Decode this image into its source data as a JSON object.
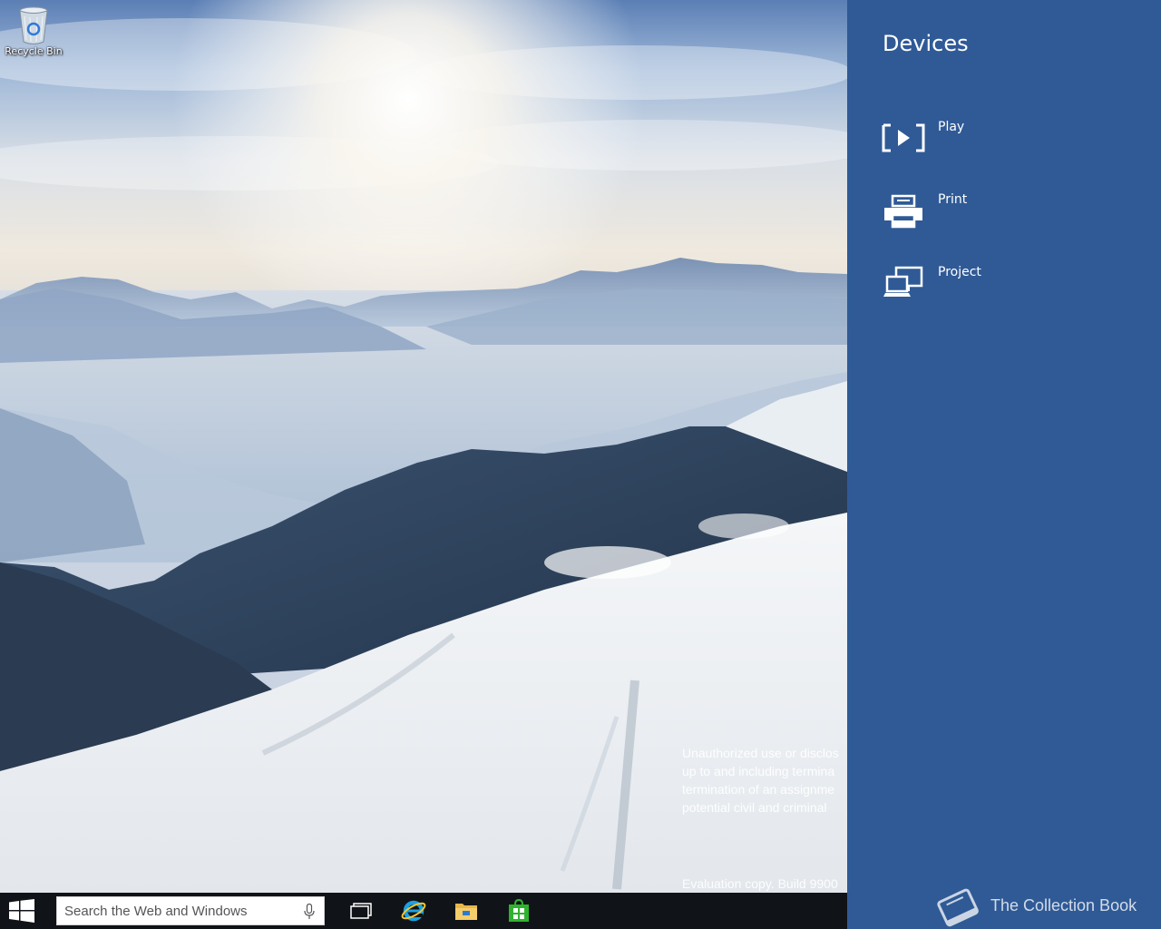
{
  "desktop": {
    "recycle_bin_label": "Recycle Bin",
    "watermark_lines": [
      "Unauthorized use or disclos",
      "up to and including termina",
      "termination of an assignme",
      "potential civil and criminal"
    ],
    "build_text": "Evaluation copy. Build 9900"
  },
  "taskbar": {
    "search_placeholder": "Search the Web and Windows",
    "icons": [
      "windows-logo-icon",
      "microphone-icon",
      "task-view-icon",
      "internet-explorer-icon",
      "file-explorer-icon",
      "store-icon"
    ]
  },
  "charm": {
    "title": "Devices",
    "items": [
      {
        "label": "Play",
        "icon": "play-icon"
      },
      {
        "label": "Print",
        "icon": "printer-icon"
      },
      {
        "label": "Project",
        "icon": "project-icon"
      }
    ],
    "brand_text": "The Collection Book",
    "colors": {
      "panel_bg": "#2f5a96",
      "text": "#ffffff"
    }
  }
}
